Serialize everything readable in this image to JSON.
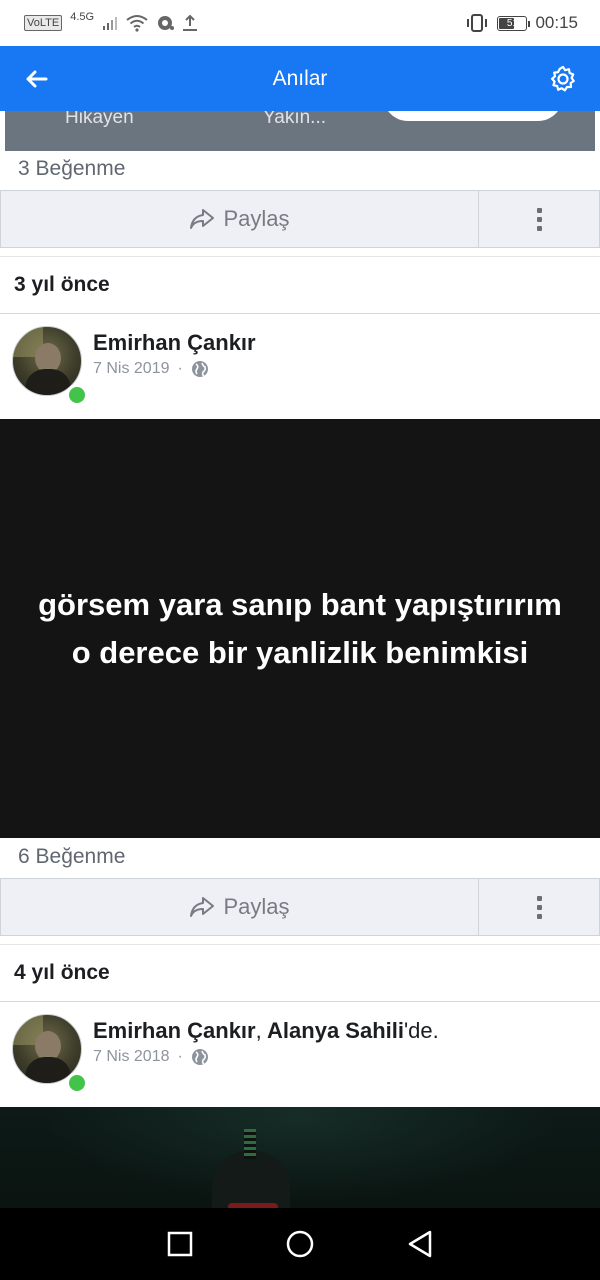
{
  "status_bar": {
    "volte": "VoLTE",
    "network": "4.5G",
    "battery": "51",
    "time": "00:15"
  },
  "app_bar": {
    "title": "Anılar",
    "back_icon": "arrow-left-icon",
    "settings_icon": "gear-icon",
    "color": "#1877f2"
  },
  "previous_post": {
    "image_text_1": "Hikayen",
    "image_text_2": "Yakın...",
    "likes": "3 Beğenme",
    "share_label": "Paylaş"
  },
  "sections": [
    {
      "header": "3 yıl önce",
      "post": {
        "author": "Emirhan Çankır",
        "date": "7 Nis 2019",
        "separator": "·",
        "status_text": "görsem yara sanıp bant yapıştırırım o derece bir yanlizlik benimkisi",
        "likes": "6 Beğenme",
        "share_label": "Paylaş"
      }
    },
    {
      "header": "4 yıl önce",
      "post": {
        "author": "Emirhan Çankır",
        "separator_comma": ",",
        "location": "Alanya Sahili",
        "location_suffix": "'de.",
        "date": "7 Nis 2018",
        "separator": "·"
      }
    }
  ],
  "nav_bar": {
    "recents_icon": "square-icon",
    "home_icon": "circle-icon",
    "back_icon": "triangle-back-icon"
  }
}
